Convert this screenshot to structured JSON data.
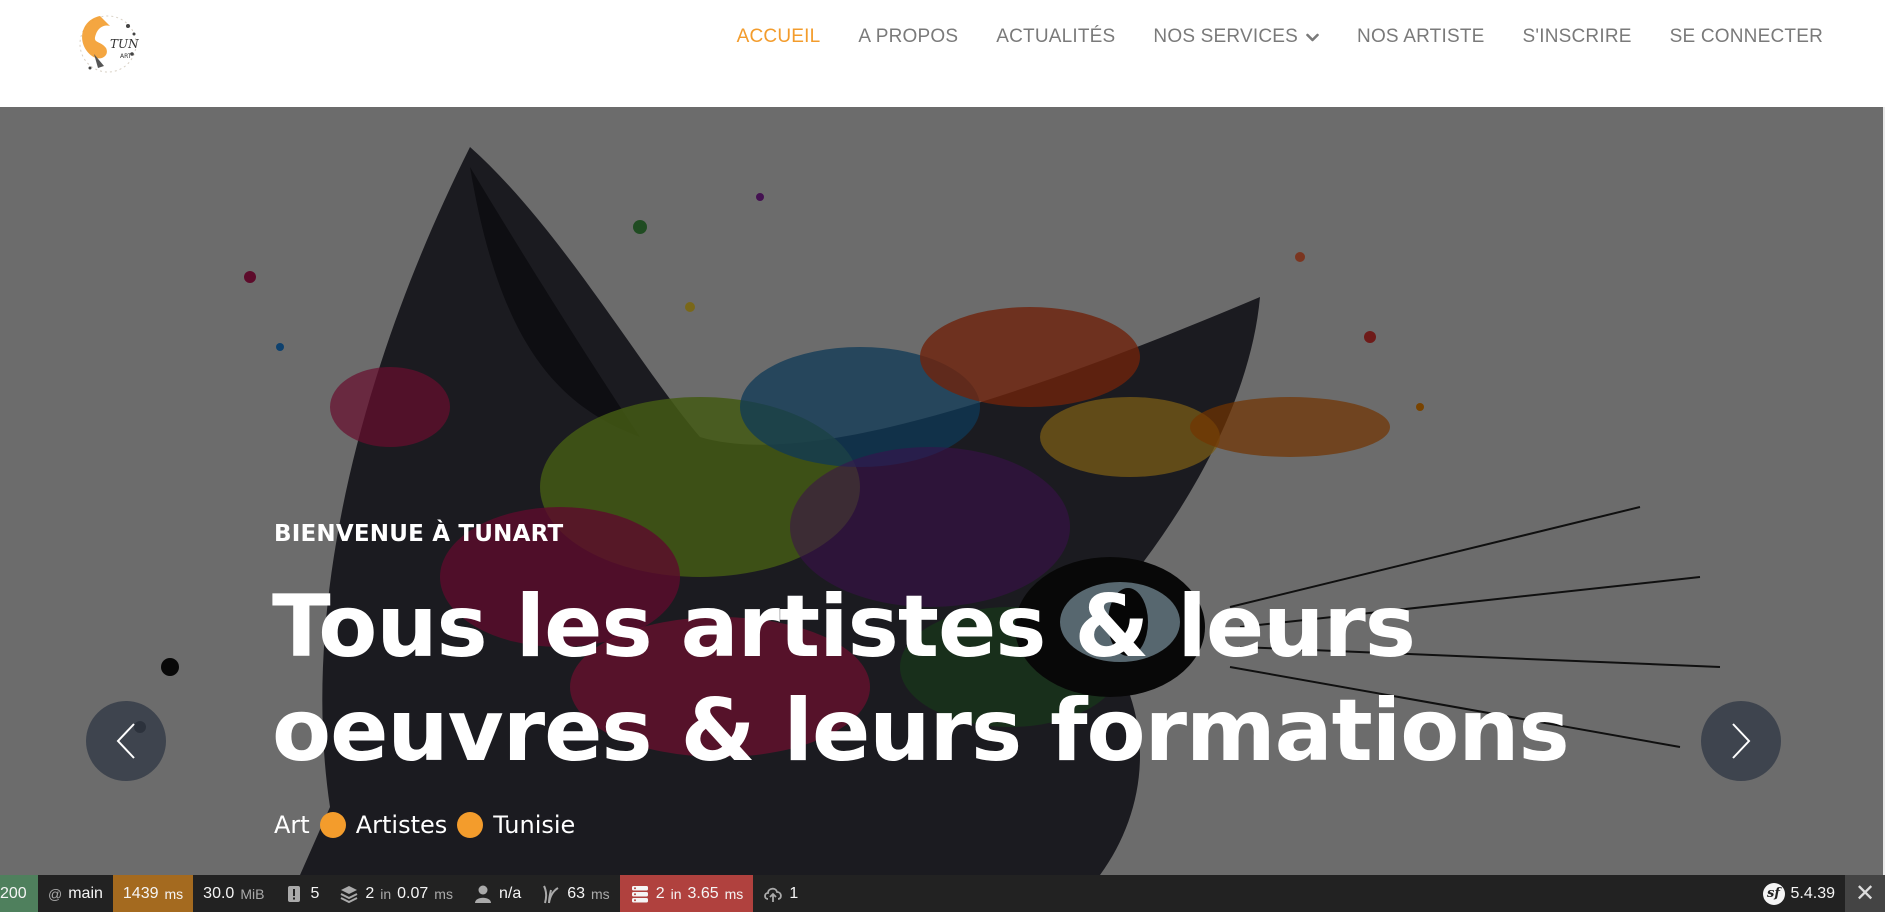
{
  "header": {
    "logo_text": "TUN ART",
    "nav": [
      {
        "label": "ACCUEIL",
        "active": true
      },
      {
        "label": "A PROPOS"
      },
      {
        "label": "ACTUALITÉS"
      },
      {
        "label": "NOS SERVICES",
        "icon": "chevron-down-icon"
      },
      {
        "label": "NOS ARTISTE"
      },
      {
        "label": "S'INSCRIRE"
      },
      {
        "label": "SE CONNECTER"
      }
    ]
  },
  "hero": {
    "subtitle": "BIENVENUE À TUNART",
    "title": "Tous les artistes & leurs oeuvres & leurs formations",
    "tags": [
      "Art",
      "Artistes",
      "Tunisie"
    ],
    "prev_icon": "chevron-left-icon",
    "next_icon": "chevron-right-icon"
  },
  "debug_toolbar": {
    "status_code": "200",
    "route_prefix": "@",
    "route": "main",
    "time_value": "1439",
    "time_unit": "ms",
    "memory_value": "30.0",
    "memory_unit": "MiB",
    "logs_count": "5",
    "cache_calls": "2",
    "cache_in": "in",
    "cache_time": "0.07",
    "cache_unit": "ms",
    "user": "n/a",
    "twig_time": "63",
    "twig_unit": "ms",
    "db_queries": "2",
    "db_in": "in",
    "db_time": "3.65",
    "db_unit": "ms",
    "events_count": "1",
    "symfony_version": "5.4.39"
  },
  "colors": {
    "accent": "#f39c2c",
    "nav_text": "#7a7a7a",
    "toolbar_bg": "#222222",
    "status_ok": "#4f805d",
    "time_badge": "#a46a1f",
    "db_badge": "#b0413e"
  }
}
